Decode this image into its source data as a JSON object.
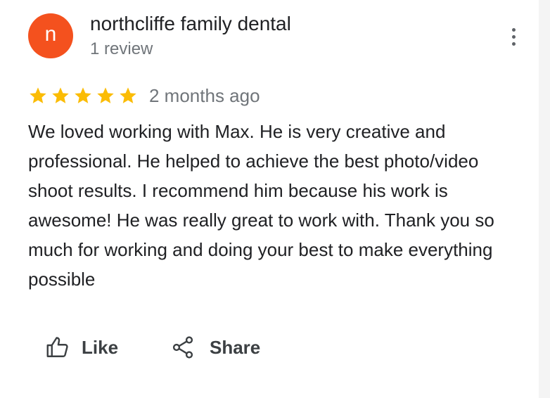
{
  "review": {
    "avatar_initial": "n",
    "reviewer_name": "northcliffe family dental",
    "review_count": "1 review",
    "rating": 5,
    "date": "2 months ago",
    "text": "We loved working with Max. He is very creative and professional. He helped to achieve the best photo/video shoot results. I recommend him because his work is awesome! He was really great to work with. Thank you so much for working and doing your best to make everything possible"
  },
  "actions": {
    "like_label": "Like",
    "share_label": "Share"
  },
  "icons": {
    "more": "more-vert-icon",
    "star": "star-icon",
    "like": "thumb-up-icon",
    "share": "share-icon"
  },
  "colors": {
    "avatar_bg": "#f4511e",
    "star": "#fbbc04",
    "primary_text": "#202124",
    "secondary_text": "#70757a",
    "icon": "#5f6368"
  }
}
